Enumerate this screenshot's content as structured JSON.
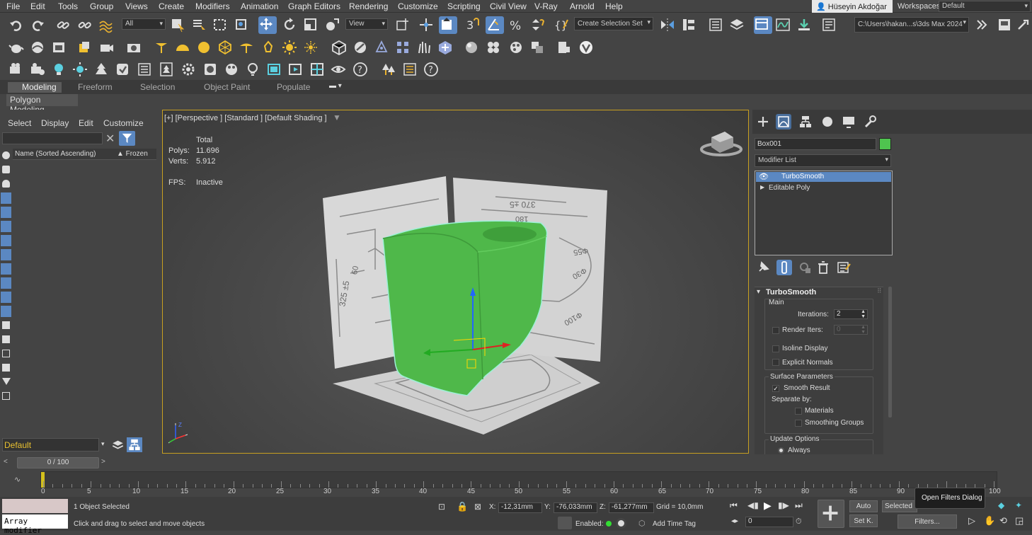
{
  "menu": [
    "File",
    "Edit",
    "Tools",
    "Group",
    "Views",
    "Create",
    "Modifiers",
    "Animation",
    "Graph Editors",
    "Rendering",
    "Customize",
    "Scripting",
    "Civil View",
    "V-Ray",
    "Arnold",
    "Help"
  ],
  "user": "Hüseyin Akdoğar",
  "workspaces_label": "Workspaces:",
  "workspace_value": "Default",
  "toolbar": {
    "filter_all": "All",
    "view_dropdown": "View",
    "selection_set": "Create Selection Set",
    "path": "C:\\Users\\hakan...s\\3ds Max 2024"
  },
  "ribbon_tabs": [
    "Modeling",
    "Freeform",
    "Selection",
    "Object Paint",
    "Populate"
  ],
  "ribbon_active": "Polygon Modeling",
  "scene_explorer": {
    "tabs": [
      "Select",
      "Display",
      "Edit",
      "Customize"
    ],
    "col_name": "Name (Sorted Ascending)",
    "col_frozen": "▲ Frozen",
    "layer": "Default"
  },
  "viewport": {
    "label": "[+] [Perspective ] [Standard ] [Default Shading ]",
    "total_label": "Total",
    "polys_label": "Polys:",
    "polys": "11.696",
    "verts_label": "Verts:",
    "verts": "5.912",
    "fps_label": "FPS:",
    "fps": "Inactive",
    "ref_texts": [
      "325 ±5",
      "370 ±5",
      "Φ55",
      "Φ30",
      "Φ100",
      "180",
      "60"
    ]
  },
  "command_panel": {
    "object_name": "Box001",
    "object_color": "#4fc44f",
    "modifier_list": "Modifier List",
    "stack": [
      "TurboSmooth",
      "Editable Poly"
    ],
    "rollout_title": "TurboSmooth",
    "main_label": "Main",
    "iterations_label": "Iterations:",
    "iterations": "2",
    "render_iters_label": "Render Iters:",
    "render_iters": "0",
    "isoline": "Isoline Display",
    "explicit_normals": "Explicit Normals",
    "surface_params": "Surface Parameters",
    "smooth_result": "Smooth Result",
    "separate_by": "Separate by:",
    "materials": "Materials",
    "smoothing_groups": "Smoothing Groups",
    "update_options": "Update Options",
    "always": "Always"
  },
  "timeline": {
    "frame": "0 / 100",
    "ticks": [
      "0",
      "5",
      "10",
      "15",
      "20",
      "25",
      "30",
      "35",
      "40",
      "45",
      "50",
      "55",
      "60",
      "65",
      "70",
      "75",
      "80",
      "85",
      "90",
      "95",
      "100"
    ]
  },
  "status": {
    "maxscript": "Array modifier",
    "selected": "1 Object Selected",
    "hint": "Click and drag to select and move objects",
    "x_label": "X:",
    "x": "-12,31mm",
    "y_label": "Y:",
    "y": "-76,033mm",
    "z_label": "Z:",
    "z": "-61,277mm",
    "grid": "Grid = 10,0mm",
    "enabled": "Enabled:",
    "add_time_tag": "Add Time Tag",
    "auto": "Auto",
    "selected_btn": "Selected",
    "set_key": "Set K.",
    "filters": "Filters...",
    "tooltip": "Open Filters Dialog",
    "frame_field": "0"
  }
}
